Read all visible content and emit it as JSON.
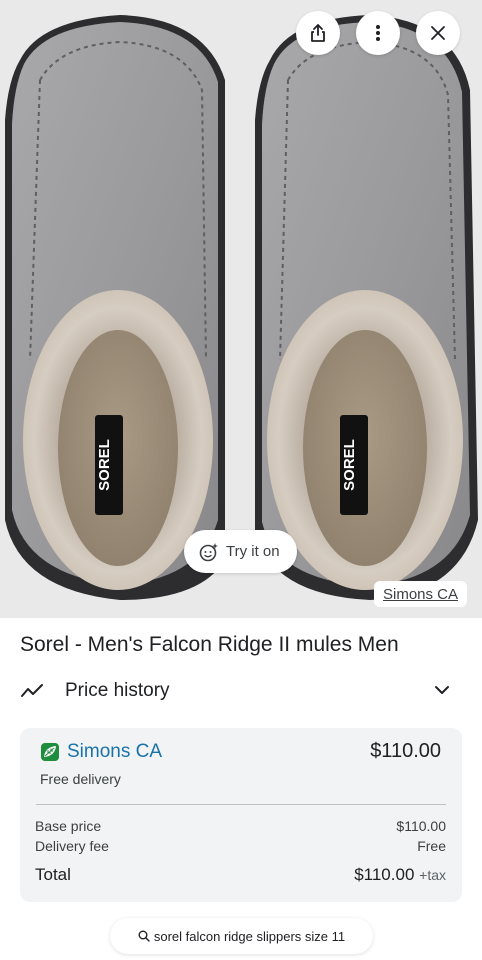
{
  "image": {
    "source_chip": "Simons CA",
    "try_on_label": "Try it on",
    "left_insole_logo": "SOREL",
    "right_insole_logo": "SOREL"
  },
  "product": {
    "title": "Sorel - Men's Falcon Ridge II mules Men"
  },
  "price_history": {
    "label": "Price history"
  },
  "offer": {
    "merchant": "Simons CA",
    "price": "$110.00",
    "delivery_note": "Free delivery",
    "breakdown": {
      "base_price_label": "Base price",
      "base_price_value": "$110.00",
      "delivery_fee_label": "Delivery fee",
      "delivery_fee_value": "Free",
      "total_label": "Total",
      "total_value": "$110.00",
      "tax_suffix": "+tax"
    }
  },
  "search": {
    "query": "sorel falcon ridge slippers size 11"
  },
  "colors": {
    "merchant_link": "#1a73a8",
    "card_bg": "#f1f3f4",
    "merchant_icon": "#1e8e3e"
  },
  "icons": [
    "share-icon",
    "more-vert-icon",
    "close-icon",
    "try-on-face-icon",
    "trend-icon",
    "chevron-down-icon",
    "merchant-leaf-icon",
    "search-icon"
  ]
}
